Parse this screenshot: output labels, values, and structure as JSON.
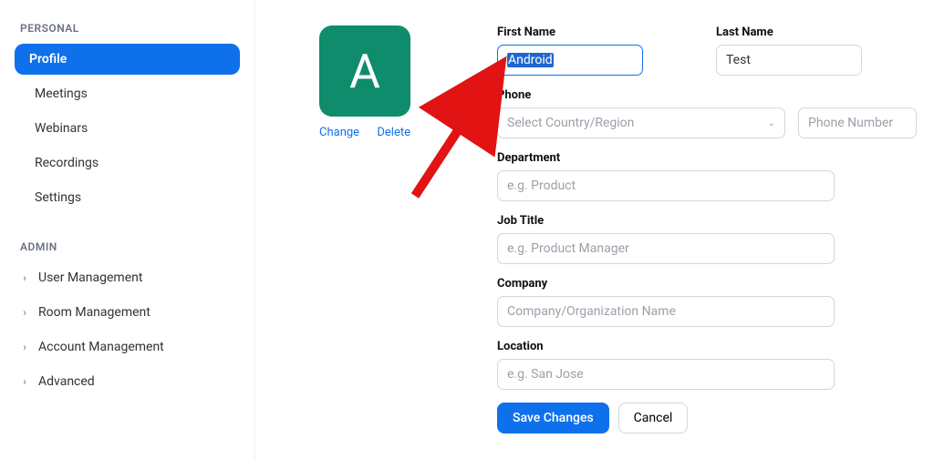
{
  "sidebar": {
    "personal_heading": "PERSONAL",
    "personal_items": [
      {
        "label": "Profile",
        "active": true
      },
      {
        "label": "Meetings"
      },
      {
        "label": "Webinars"
      },
      {
        "label": "Recordings"
      },
      {
        "label": "Settings"
      }
    ],
    "admin_heading": "ADMIN",
    "admin_items": [
      {
        "label": "User Management"
      },
      {
        "label": "Room Management"
      },
      {
        "label": "Account Management"
      },
      {
        "label": "Advanced"
      }
    ]
  },
  "avatar": {
    "initial": "A",
    "change_label": "Change",
    "delete_label": "Delete"
  },
  "form": {
    "first_name_label": "First Name",
    "first_name_value": "Android",
    "last_name_label": "Last Name",
    "last_name_value": "Test",
    "phone_label": "Phone",
    "phone_country_placeholder": "Select Country/Region",
    "phone_number_placeholder": "Phone Number",
    "department_label": "Department",
    "department_placeholder": "e.g. Product",
    "job_title_label": "Job Title",
    "job_title_placeholder": "e.g. Product Manager",
    "company_label": "Company",
    "company_placeholder": "Company/Organization Name",
    "location_label": "Location",
    "location_placeholder": "e.g. San Jose",
    "save_label": "Save Changes",
    "cancel_label": "Cancel"
  },
  "colors": {
    "primary": "#0e71eb",
    "avatar_bg": "#0f8c6c",
    "arrow": "#e11313"
  }
}
